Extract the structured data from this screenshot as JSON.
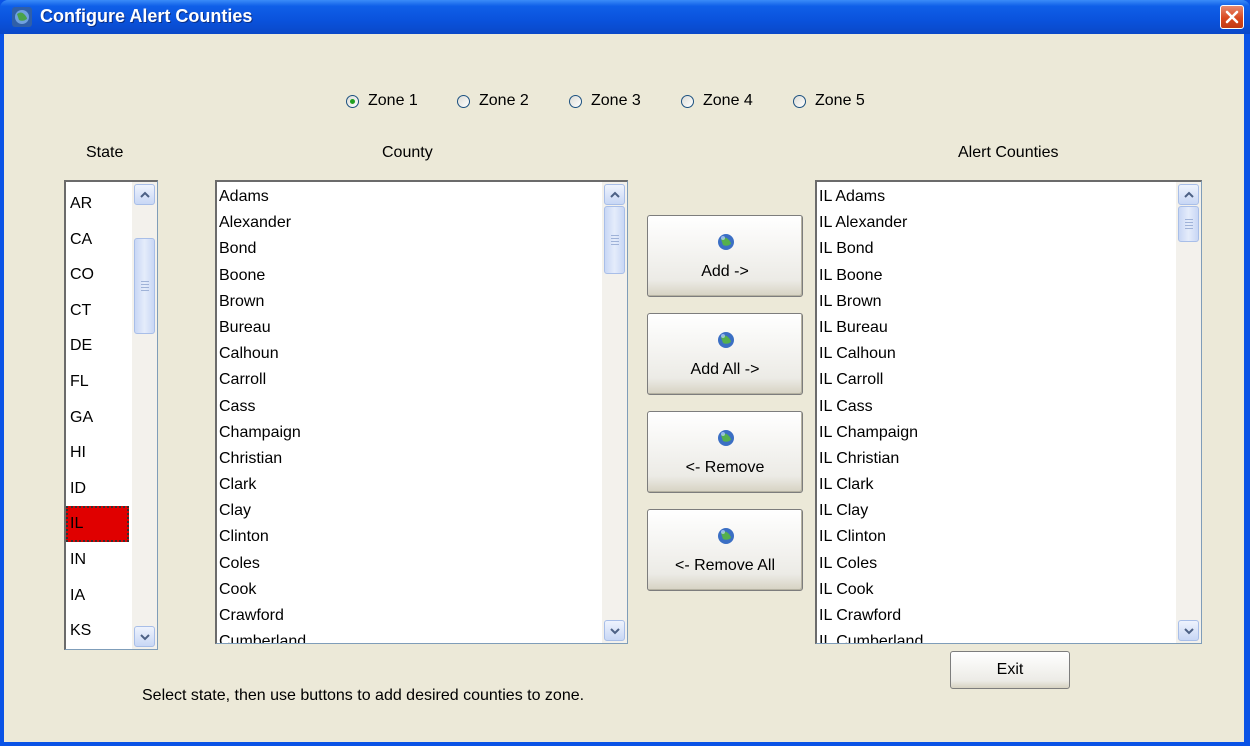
{
  "window": {
    "title": "Configure Alert Counties"
  },
  "zones": [
    {
      "label": "Zone 1",
      "checked": true
    },
    {
      "label": "Zone 2",
      "checked": false
    },
    {
      "label": "Zone 3",
      "checked": false
    },
    {
      "label": "Zone 4",
      "checked": false
    },
    {
      "label": "Zone 5",
      "checked": false
    }
  ],
  "labels": {
    "state": "State",
    "county": "County",
    "alert_counties": "Alert Counties"
  },
  "states": [
    "AR",
    "CA",
    "CO",
    "CT",
    "DE",
    "FL",
    "GA",
    "HI",
    "ID",
    "IL",
    "IN",
    "IA",
    "KS"
  ],
  "selected_state": "IL",
  "counties": [
    "Adams",
    "Alexander",
    "Bond",
    "Boone",
    "Brown",
    "Bureau",
    "Calhoun",
    "Carroll",
    "Cass",
    "Champaign",
    "Christian",
    "Clark",
    "Clay",
    "Clinton",
    "Coles",
    "Cook",
    "Crawford",
    "Cumberland"
  ],
  "alert_counties": [
    "IL Adams",
    "IL Alexander",
    "IL Bond",
    "IL Boone",
    "IL Brown",
    "IL Bureau",
    "IL Calhoun",
    "IL Carroll",
    "IL Cass",
    "IL Champaign",
    "IL Christian",
    "IL Clark",
    "IL Clay",
    "IL Clinton",
    "IL Coles",
    "IL Cook",
    "IL Crawford",
    "IL Cumberland"
  ],
  "buttons": {
    "add": "Add ->",
    "add_all": "Add All ->",
    "remove": "<- Remove",
    "remove_all": "<- Remove All",
    "exit": "Exit"
  },
  "instructions": "Select state, then use buttons to add desired counties to zone.",
  "colors": {
    "selected_state_bg": "#e00000",
    "titlebar": "#0a52dc",
    "client_bg": "#ece9d8"
  }
}
